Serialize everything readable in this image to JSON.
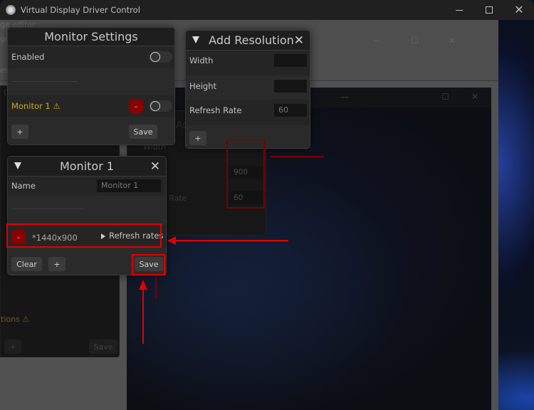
{
  "window": {
    "title": "Virtual Display Driver Control",
    "controls": {
      "minimize": "minimize-icon",
      "maximize": "maximize-icon",
      "close": "close-icon"
    }
  },
  "background": {
    "ghost_left_labels": [
      "ge editor",
      "ge",
      "es",
      "D"
    ],
    "ghost_warning": "tions ⚠",
    "ghost_plus": "+",
    "ghost_save": "Save",
    "ghost_dialog": {
      "title_partial": "Add",
      "width_label": "Width",
      "height_value": "900",
      "refresh_label": "sh Rate",
      "refresh_value": "60"
    }
  },
  "monitor_settings": {
    "title": "Monitor Settings",
    "enabled_label": "Enabled",
    "enabled": false,
    "monitors": [
      {
        "name": "Monitor 1",
        "warning_icon": "⚠",
        "remove_label": "-",
        "enabled": false
      }
    ],
    "add_label": "+",
    "save_label": "Save"
  },
  "add_resolution": {
    "title": "Add Resolution",
    "collapse_icon": "▼",
    "close_icon": "✕",
    "width_label": "Width",
    "width_value": "",
    "height_label": "Height",
    "height_value": "",
    "refresh_label": "Refresh Rate",
    "refresh_value": "60",
    "add_label": "+"
  },
  "monitor_1": {
    "title": "Monitor 1",
    "collapse_icon": "▼",
    "close_icon": "✕",
    "name_label": "Name",
    "name_value": "Monitor 1",
    "resolutions": [
      {
        "remove_label": "-",
        "resolution": "*1440x900",
        "refresh_rates_label": "Refresh rates"
      }
    ],
    "clear_label": "Clear",
    "add_label": "+",
    "save_label": "Save"
  },
  "annotation_color": "#e00000"
}
